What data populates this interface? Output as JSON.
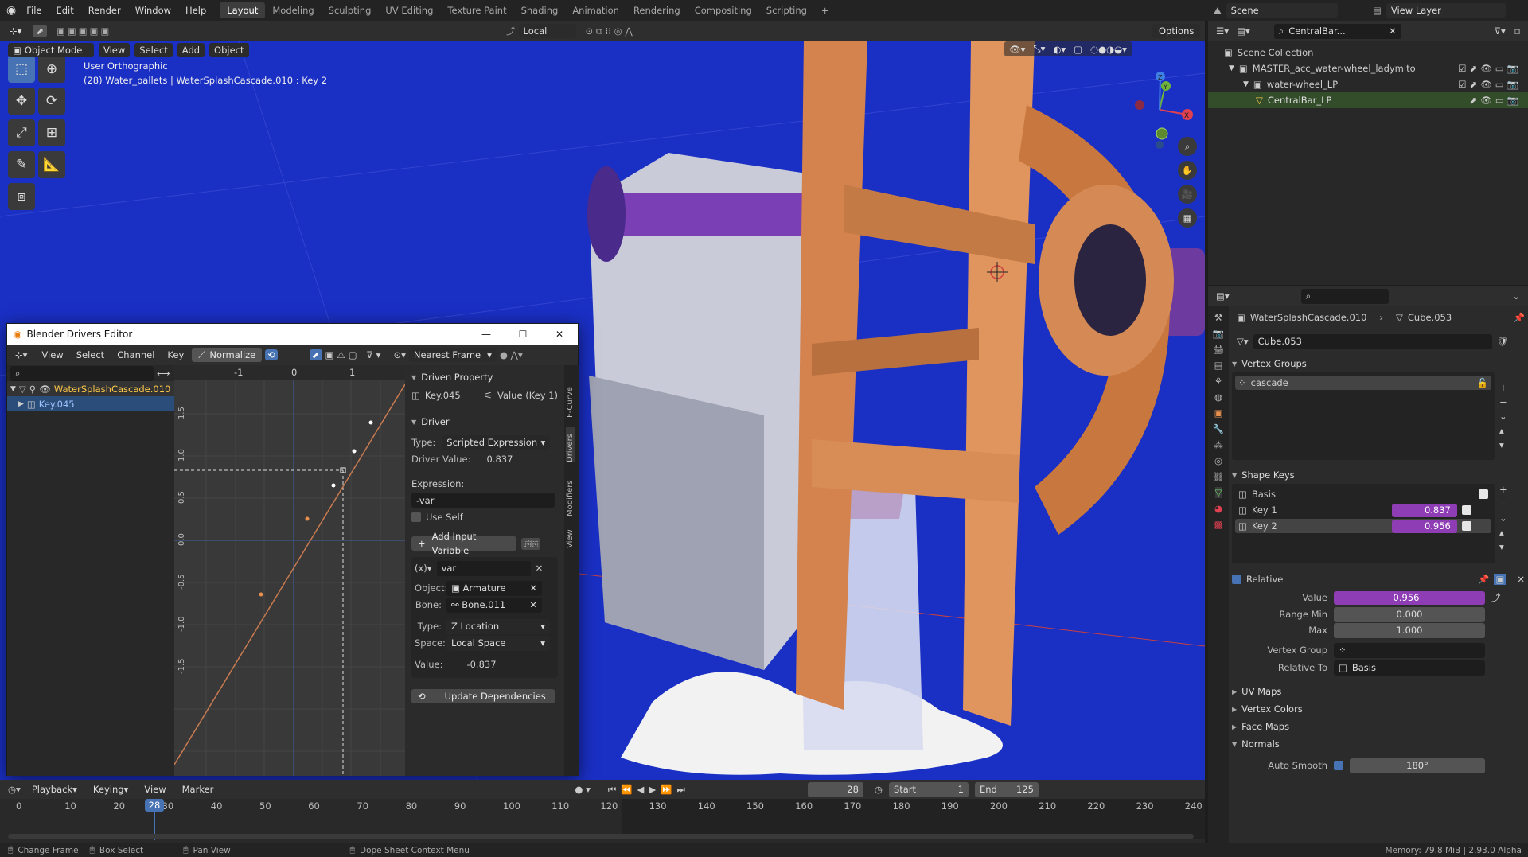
{
  "topbar": {
    "menus": [
      "File",
      "Edit",
      "Render",
      "Window",
      "Help"
    ],
    "workspaces": [
      "Layout",
      "Modeling",
      "Sculpting",
      "UV Editing",
      "Texture Paint",
      "Shading",
      "Animation",
      "Rendering",
      "Compositing",
      "Scripting"
    ],
    "active": "Layout",
    "scene_label": "Scene",
    "view_layer_label": "View Layer"
  },
  "viewport": {
    "mode": "Object Mode",
    "menus": [
      "View",
      "Select",
      "Add",
      "Object"
    ],
    "transform": "Local",
    "options": "Options",
    "overlay_line1": "User Orthographic",
    "overlay_line2": "(28) Water_pallets | WaterSplashCascade.010 : Key 2"
  },
  "drivers": {
    "title": "Blender Drivers Editor",
    "menus": [
      "View",
      "Select",
      "Channel",
      "Key"
    ],
    "normalize": "Normalize",
    "nearest": "Nearest Frame",
    "channel_object": "WaterSplashCascade.010",
    "channel_key": "Key.045",
    "x_ticks": [
      "-1",
      "0",
      "1"
    ],
    "y_ticks": [
      "1.5",
      "1.0",
      "0.5",
      "0.0",
      "-0.5",
      "-1.0",
      "-1.5"
    ],
    "tabs": [
      "F-Curve",
      "Drivers",
      "Modifiers",
      "View"
    ],
    "driven_property": "Driven Property",
    "dp_key": "Key.045",
    "dp_value": "Value (Key 1)",
    "driver_head": "Driver",
    "type_label": "Type:",
    "type_value": "Scripted Expression",
    "driver_value_label": "Driver Value:",
    "driver_value": "0.837",
    "expression_label": "Expression:",
    "expression": "-var",
    "use_self": "Use Self",
    "add_var": "Add Input Variable",
    "var_name": "var",
    "object_label": "Object:",
    "object_value": "Armature",
    "bone_label": "Bone:",
    "bone_value": "Bone.011",
    "vtype_label": "Type:",
    "vtype_value": "Z Location",
    "space_label": "Space:",
    "space_value": "Local Space",
    "value_label": "Value:",
    "value": "-0.837",
    "update": "Update Dependencies"
  },
  "outliner": {
    "search": "CentralBar...",
    "scene_collection": "Scene Collection",
    "items": [
      "MASTER_acc_water-wheel_ladymito",
      "water-wheel_LP",
      "CentralBar_LP"
    ]
  },
  "properties": {
    "object": "WaterSplashCascade.010",
    "mesh": "Cube.053",
    "mesh_field": "Cube.053",
    "vertex_groups": "Vertex Groups",
    "vg_item": "cascade",
    "shape_keys": "Shape Keys",
    "keys": [
      {
        "name": "Basis",
        "value": ""
      },
      {
        "name": "Key 1",
        "value": "0.837"
      },
      {
        "name": "Key 2",
        "value": "0.956"
      }
    ],
    "relative": "Relative",
    "value_label": "Value",
    "value": "0.956",
    "range_min_label": "Range Min",
    "range_min": "0.000",
    "max_label": "Max",
    "max": "1.000",
    "vgroup_label": "Vertex Group",
    "relative_to_label": "Relative To",
    "relative_to": "Basis",
    "collapsed": [
      "UV Maps",
      "Vertex Colors",
      "Face Maps",
      "Normals"
    ],
    "auto_smooth": "Auto Smooth",
    "angle": "180°"
  },
  "timeline": {
    "menus": [
      "Playback",
      "Keying",
      "View",
      "Marker"
    ],
    "frame": "28",
    "start_label": "Start",
    "start": "1",
    "end_label": "End",
    "end": "125",
    "ticks": [
      "0",
      "10",
      "20",
      "30",
      "40",
      "50",
      "60",
      "70",
      "80",
      "90",
      "100",
      "110",
      "120",
      "130",
      "140",
      "150",
      "160",
      "170",
      "180",
      "190",
      "200",
      "210",
      "220",
      "230",
      "240"
    ]
  },
  "status": {
    "change_frame": "Change Frame",
    "box_select": "Box Select",
    "pan": "Pan View",
    "context": "Dope Sheet Context Menu",
    "memory": "Memory: 79.8 MiB | 2.93.0 Alpha"
  }
}
